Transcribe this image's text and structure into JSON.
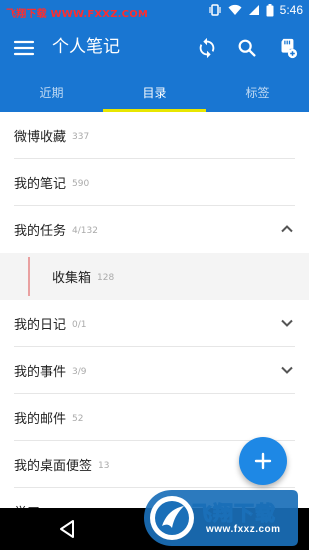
{
  "status_bar": {
    "watermark": "飞翔下载 WWW.FXXZ.COM",
    "time": "5:46"
  },
  "app_bar": {
    "title": "个人笔记",
    "icons": [
      "menu-icon",
      "sync-icon",
      "search-icon",
      "sd-card-add-icon"
    ]
  },
  "tabs": [
    {
      "label": "近期",
      "active": false
    },
    {
      "label": "目录",
      "active": true
    },
    {
      "label": "标签",
      "active": false
    }
  ],
  "list": [
    {
      "label": "微博收藏",
      "count": "337"
    },
    {
      "label": "我的笔记",
      "count": "590"
    },
    {
      "label": "我的任务",
      "count": "4/132",
      "chevron": "up"
    },
    {
      "label": "收集箱",
      "count": "128",
      "sub": true
    },
    {
      "label": "我的日记",
      "count": "0/1",
      "chevron": "down"
    },
    {
      "label": "我的事件",
      "count": "3/9",
      "chevron": "down"
    },
    {
      "label": "我的邮件",
      "count": "52"
    },
    {
      "label": "我的桌面便签",
      "count": "13"
    },
    {
      "label": "学习",
      "count": ""
    }
  ],
  "fab": {
    "icon": "plus-icon"
  },
  "watermark_logo": {
    "text": "飞翔下载",
    "url": "www.fxxz.com"
  },
  "colors": {
    "primary": "#1976d2",
    "fab": "#1e88e5",
    "tab_indicator": "#e8e600",
    "sub_bar": "#e9a0a0"
  }
}
